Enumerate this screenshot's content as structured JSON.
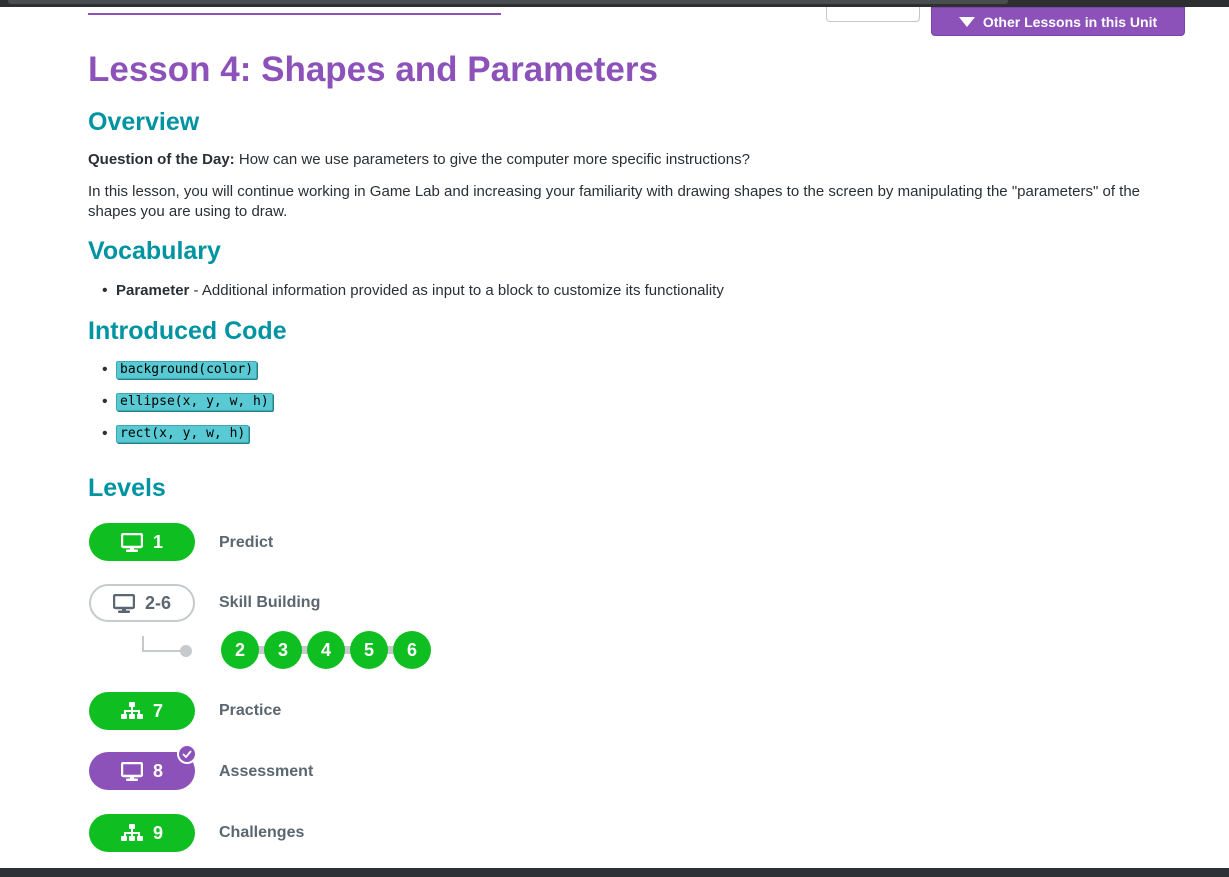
{
  "header": {
    "other_lessons_label": "Other Lessons in this Unit"
  },
  "lesson": {
    "title": "Lesson 4: Shapes and Parameters"
  },
  "overview": {
    "heading": "Overview",
    "qotd_label": "Question of the Day:",
    "qotd_text": " How can we use parameters to give the computer more specific instructions?",
    "description": "In this lesson, you will continue working in Game Lab and increasing your familiarity with drawing shapes to the screen by manipulating the \"parameters\" of the shapes you are using to draw."
  },
  "vocabulary": {
    "heading": "Vocabulary",
    "items": [
      {
        "term": "Parameter",
        "definition": " - Additional information provided as input to a block to customize its functionality"
      }
    ]
  },
  "introduced_code": {
    "heading": "Introduced Code",
    "items": [
      "background(color)",
      "ellipse(x, y, w, h)",
      "rect(x, y, w, h)"
    ]
  },
  "levels": {
    "heading": "Levels",
    "items": [
      {
        "number": "1",
        "label": "Predict",
        "icon": "desktop-icon",
        "status": "completed"
      },
      {
        "number": "2-6",
        "label": "Skill Building",
        "icon": "desktop-icon",
        "status": "group",
        "sublevels": [
          "2",
          "3",
          "4",
          "5",
          "6"
        ]
      },
      {
        "number": "7",
        "label": "Practice",
        "icon": "sitemap-icon",
        "status": "completed"
      },
      {
        "number": "8",
        "label": "Assessment",
        "icon": "desktop-icon",
        "status": "assessment-submitted"
      },
      {
        "number": "9",
        "label": "Challenges",
        "icon": "sitemap-icon",
        "status": "completed"
      }
    ]
  },
  "colors": {
    "purple": "#8c52ba",
    "teal": "#0094a3",
    "green": "#0fbf21",
    "code_bg": "#59cad3",
    "gray": "#c6cacd"
  }
}
